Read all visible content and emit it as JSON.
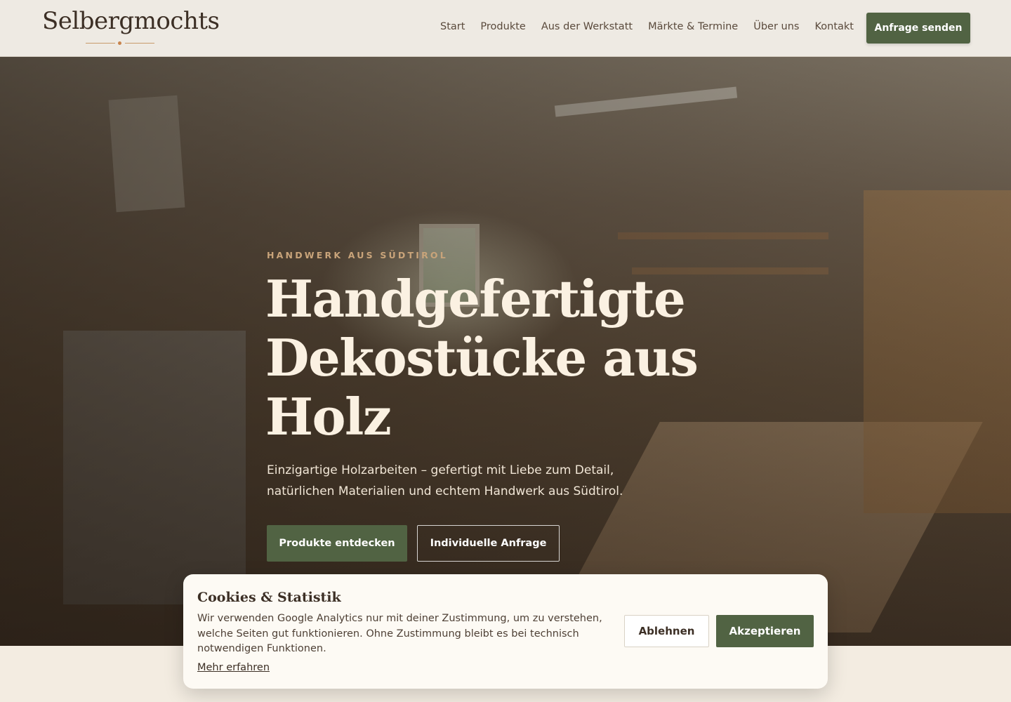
{
  "header": {
    "logo_text": "Selbergmochts",
    "nav": [
      {
        "label": "Start"
      },
      {
        "label": "Produkte"
      },
      {
        "label": "Aus der Werkstatt"
      },
      {
        "label": "Märkte & Termine"
      },
      {
        "label": "Über uns"
      },
      {
        "label": "Kontakt"
      }
    ],
    "cta_label": "Anfrage senden"
  },
  "hero": {
    "eyebrow": "HANDWERK AUS SÜDTIROL",
    "title": "Handgefertigte Dekostücke aus Holz",
    "subtitle": "Einzigartige Holzarbeiten – gefertigt mit Liebe zum Detail, natürlichen Materialien und echtem Handwerk aus Südtirol.",
    "primary_button": "Produkte entdecken",
    "secondary_button": "Individuelle Anfrage",
    "background_image": "workshop-photo"
  },
  "cookie_banner": {
    "title": "Cookies & Statistik",
    "text": "Wir verwenden Google Analytics nur mit deiner Zustimmung, um zu verstehen, welche Seiten gut funktionieren. Ohne Zustimmung bleibt es bei technisch notwendigen Funktionen.",
    "link": "Mehr erfahren",
    "decline_button": "Ablehnen",
    "accept_button": "Akzeptieren"
  },
  "colors": {
    "accent_green": "#516343",
    "eyebrow_gold": "#c9a47a",
    "header_bg": "#eeeae3",
    "page_bg": "#f3ece1"
  }
}
